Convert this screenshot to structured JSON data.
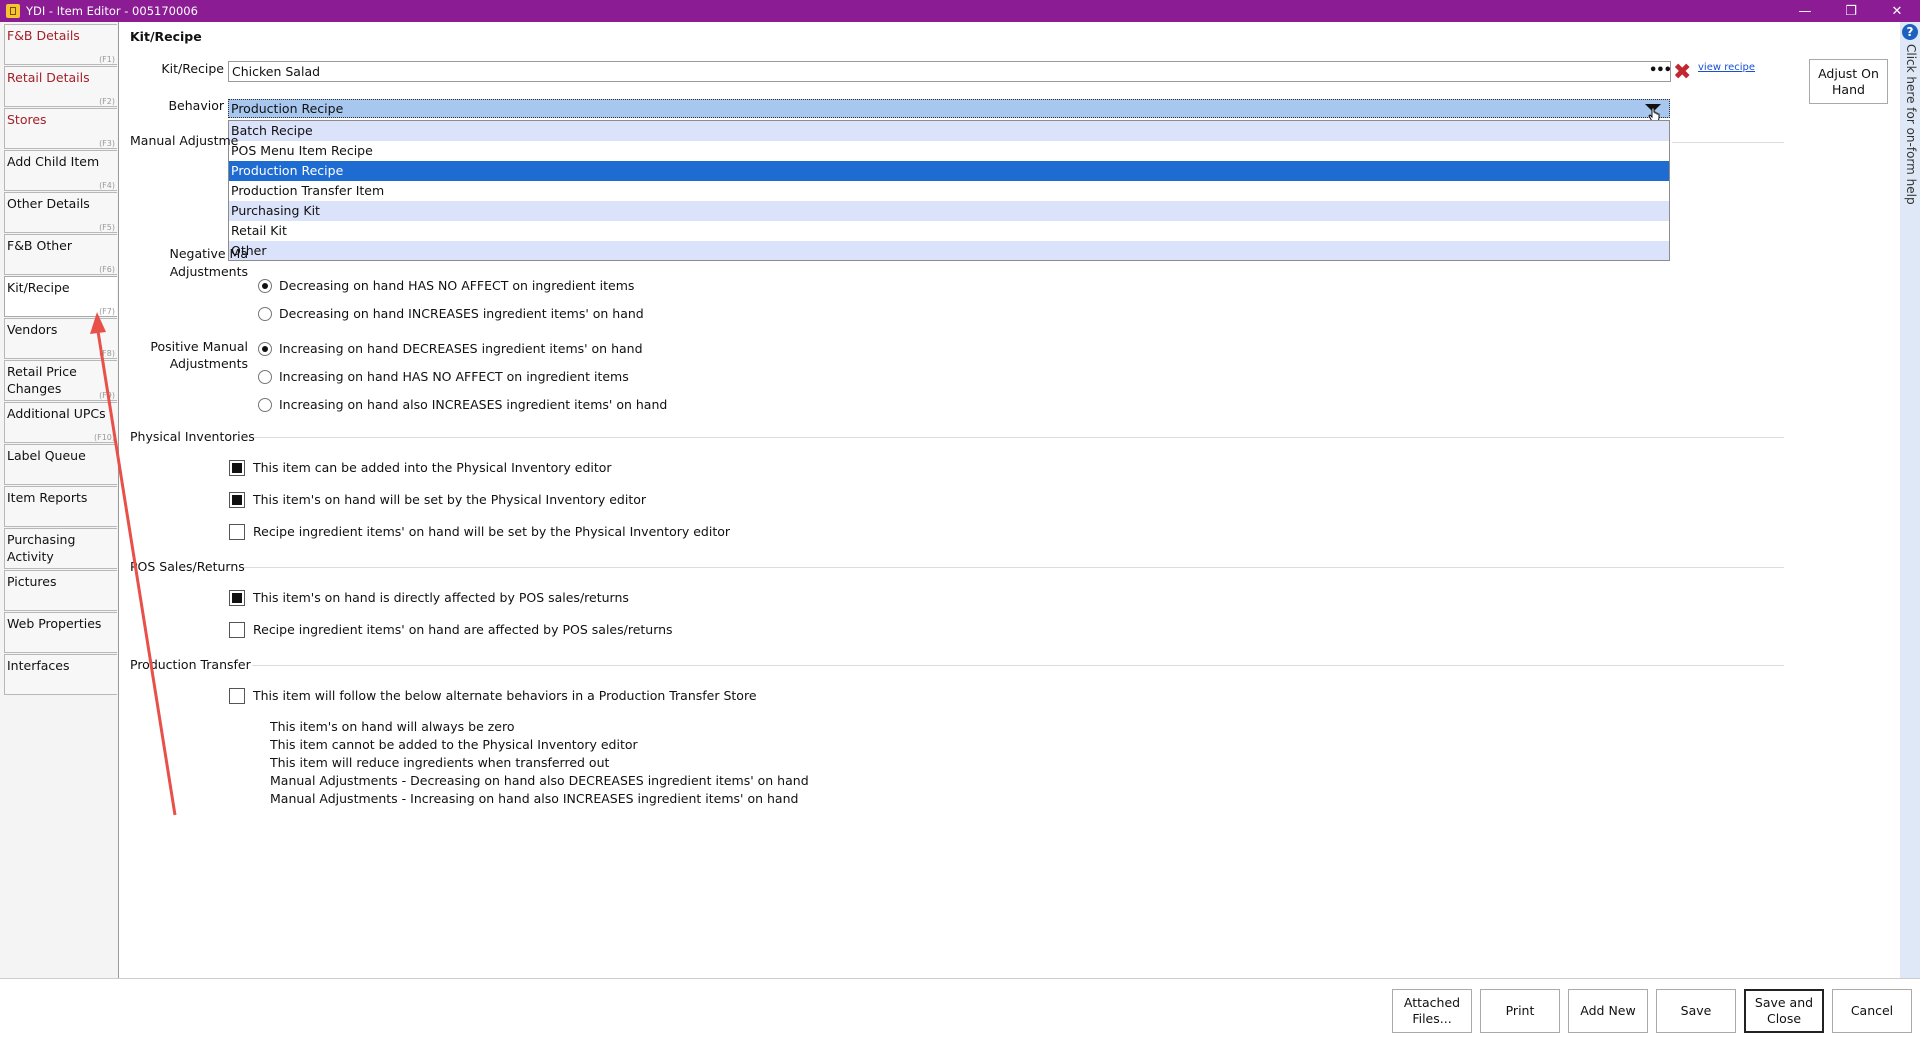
{
  "window": {
    "title": "YDI - Item Editor - 005170006",
    "minimize": "—",
    "restore": "❐",
    "close": "✕"
  },
  "sidebar": {
    "tabs": [
      {
        "label": "F&B Details",
        "fkey": "(F1)",
        "red": true
      },
      {
        "label": "Retail Details",
        "fkey": "(F2)",
        "red": true
      },
      {
        "label": "Stores",
        "fkey": "(F3)",
        "red": true
      },
      {
        "label": "Add Child Item",
        "fkey": "(F4)"
      },
      {
        "label": "Other Details",
        "fkey": "(F5)"
      },
      {
        "label": "F&B Other",
        "fkey": "(F6)"
      },
      {
        "label": "Kit/Recipe",
        "fkey": "(F7)",
        "active": true
      },
      {
        "label": "Vendors",
        "fkey": "(F8)"
      },
      {
        "label": "Retail Price Changes",
        "fkey": "(F9)"
      },
      {
        "label": "Additional UPCs",
        "fkey": "(F10)"
      },
      {
        "label": "Label Queue",
        "fkey": ""
      },
      {
        "label": "Item Reports",
        "fkey": ""
      },
      {
        "label": "Purchasing Activity",
        "fkey": ""
      },
      {
        "label": "Pictures",
        "fkey": ""
      },
      {
        "label": "Web Properties",
        "fkey": ""
      },
      {
        "label": "Interfaces",
        "fkey": ""
      }
    ]
  },
  "page": {
    "heading": "Kit/Recipe",
    "kit_label": "Kit/Recipe",
    "kit_value": "Chicken Salad",
    "browse": "•••",
    "clear": "✖",
    "view_recipe": "view recipe",
    "adjust_button": "Adjust On Hand",
    "behavior_label": "Behavior",
    "behavior_value": "Production Recipe",
    "manual_label": "Manual Adjustme",
    "negative_label": "Negative Ma",
    "adjustments_label": "Adjustments"
  },
  "dropdown": {
    "options": [
      {
        "label": "Batch Recipe",
        "state": "alt"
      },
      {
        "label": "POS Menu Item Recipe",
        "state": ""
      },
      {
        "label": "Production Recipe",
        "state": "sel"
      },
      {
        "label": "Production Transfer Item",
        "state": ""
      },
      {
        "label": "Purchasing Kit",
        "state": "alt"
      },
      {
        "label": "Retail Kit",
        "state": ""
      },
      {
        "label": "Other",
        "state": "alt"
      }
    ]
  },
  "negative": {
    "options": [
      {
        "label": "Decreasing on hand HAS NO AFFECT on ingredient items",
        "checked": true
      },
      {
        "label": "Decreasing on hand INCREASES ingredient items' on hand",
        "checked": false
      }
    ]
  },
  "positive": {
    "label": "Positive Manual Adjustments",
    "options": [
      {
        "label": "Increasing on hand DECREASES ingredient items' on hand",
        "checked": true
      },
      {
        "label": "Increasing on hand HAS NO AFFECT on ingredient items",
        "checked": false
      },
      {
        "label": "Increasing on hand also INCREASES ingredient items' on hand",
        "checked": false
      }
    ]
  },
  "physical": {
    "heading": "Physical Inventories",
    "options": [
      {
        "label": "This item can be added into the Physical Inventory editor",
        "checked": true
      },
      {
        "label": "This item's on hand will be set by the Physical Inventory editor",
        "checked": true
      },
      {
        "label": "Recipe ingredient items' on hand will be set by the Physical Inventory editor",
        "checked": false
      }
    ]
  },
  "pos": {
    "heading": "POS Sales/Returns",
    "options": [
      {
        "label": "This item's on hand is directly affected by POS sales/returns",
        "checked": true
      },
      {
        "label": "Recipe ingredient items' on hand are affected by POS sales/returns",
        "checked": false
      }
    ]
  },
  "transfer": {
    "heading": "Production Transfer",
    "checkbox": {
      "label": "This item will follow the below alternate behaviors in a Production Transfer Store",
      "checked": false
    },
    "notes": [
      "This item's on hand will always be zero",
      "This item cannot be added to the Physical Inventory editor",
      "This item will reduce ingredients when transferred out",
      "Manual Adjustments - Decreasing on hand also DECREASES ingredient items' on hand",
      "Manual Adjustments - Increasing on hand also INCREASES ingredient items' on hand"
    ]
  },
  "help": {
    "icon": "?",
    "text": "Click here for on-form help"
  },
  "footer": {
    "buttons": [
      "Attached Files...",
      "Print",
      "Add New",
      "Save",
      "Save and Close",
      "Cancel"
    ]
  },
  "colors": {
    "titlebar": "#8b1c93",
    "selected": "#1e6bd2",
    "alt_row": "#dbe3fb",
    "combo": "#a7c7ee",
    "red_tab": "#a4202a",
    "annotation_arrow": "#e8504a"
  }
}
